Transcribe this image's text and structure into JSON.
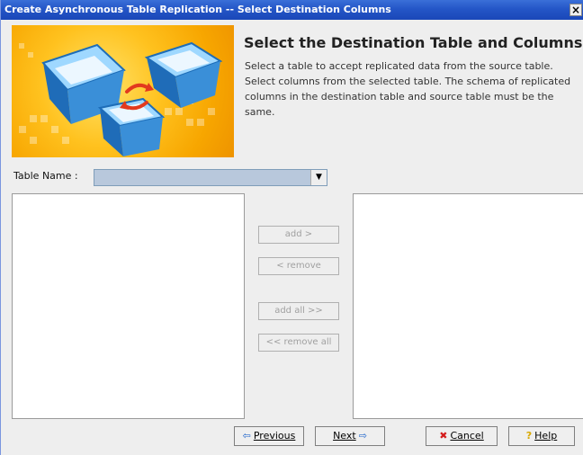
{
  "window": {
    "title": "Create Asynchronous Table Replication -- Select Destination Columns",
    "close_glyph": "×"
  },
  "header": {
    "heading": "Select the Destination Table and Columns",
    "description": "Select a table to accept replicated data from the source table. Select columns from the selected table. The schema of replicated columns in the destination table and source table must be the same."
  },
  "table_select": {
    "label": "Table Name :",
    "value": ""
  },
  "transfer_buttons": {
    "add": "add >",
    "remove": "< remove",
    "add_all": "add all >>",
    "remove_all": "<< remove all"
  },
  "footer": {
    "previous_label": "Previous",
    "next_label": "Next",
    "cancel_label": "Cancel",
    "help_label": "Help"
  },
  "colors": {
    "titlebar": "#2456c7",
    "banner": "#ffc21f",
    "select_fill": "#b8c8dc"
  },
  "icons": [
    "arrow-left-icon",
    "arrow-right-icon",
    "cancel-x-icon",
    "help-question-icon",
    "dropdown-arrow-icon",
    "close-icon"
  ]
}
